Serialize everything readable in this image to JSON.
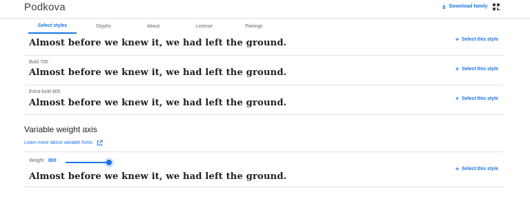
{
  "header": {
    "family_name": "Podkova",
    "download_label": "Download family",
    "grid_icon": "apps-grid-icon"
  },
  "tabs": [
    {
      "label": "Select styles",
      "active": true
    },
    {
      "label": "Glyphs",
      "active": false
    },
    {
      "label": "About",
      "active": false
    },
    {
      "label": "License",
      "active": false
    },
    {
      "label": "Pairings",
      "active": false
    }
  ],
  "styles": [
    {
      "label": "",
      "sample": "Almost before we knew it, we had left the ground.",
      "action": "Select this style"
    },
    {
      "label": "Bold 700",
      "sample": "Almost before we knew it, we had left the ground.",
      "action": "Select this style"
    },
    {
      "label": "Extra-bold 800",
      "sample": "Almost before we knew it, we had left the ground.",
      "action": "Select this style"
    }
  ],
  "variable": {
    "title": "Variable weight axis",
    "learn_more": "Learn more about variable fonts",
    "weight_label": "Weight",
    "weight_value": "800",
    "slider_fraction": 1.0,
    "sample": "Almost before we knew it, we had left the ground.",
    "action": "Select this style"
  },
  "colors": {
    "accent": "#1a73e8",
    "divider": "#e0e0e0",
    "text": "#202124",
    "muted": "#5f6368"
  }
}
